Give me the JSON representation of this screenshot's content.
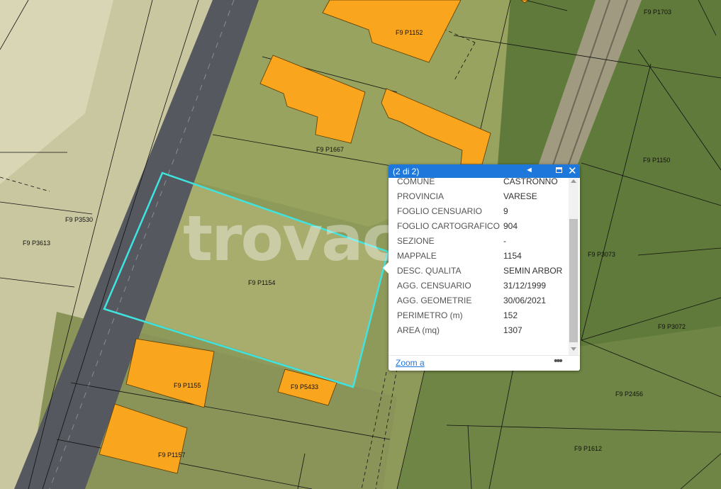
{
  "map": {
    "parcel_labels": [
      "F9 P1703",
      "F9 P1152",
      "F9 P1667",
      "F9 P1150",
      "F9 P3530",
      "F9 P3613",
      "F9 P3073",
      "F9 P1154",
      "F9 P3072",
      "F9 P1155",
      "F9 P5433",
      "F9 P2456",
      "F9 P1157",
      "F9 P1612"
    ],
    "watermark": "trovacasa",
    "colors": {
      "building": "#f9a51e",
      "selection": "#3fe4e0",
      "popup_header": "#1e78dc"
    }
  },
  "popup": {
    "counter": "(2 di 2)",
    "prev_icon": "◄",
    "close_icon": "✕",
    "fields": [
      {
        "label": "COMUNE",
        "value": "CASTRONNO"
      },
      {
        "label": "PROVINCIA",
        "value": "VARESE"
      },
      {
        "label": "FOGLIO CENSUARIO",
        "value": "9"
      },
      {
        "label": "FOGLIO CARTOGRAFICO",
        "value": "904"
      },
      {
        "label": "SEZIONE",
        "value": "-"
      },
      {
        "label": "MAPPALE",
        "value": "1154"
      },
      {
        "label": "DESC. QUALITA",
        "value": "SEMIN ARBOR"
      },
      {
        "label": "AGG. CENSUARIO",
        "value": "31/12/1999"
      },
      {
        "label": "AGG. GEOMETRIE",
        "value": "30/06/2021"
      },
      {
        "label": "PERIMETRO (m)",
        "value": "152"
      },
      {
        "label": "AREA (mq)",
        "value": "1307"
      }
    ],
    "zoom_label": "Zoom a",
    "more_icon": "•••"
  }
}
